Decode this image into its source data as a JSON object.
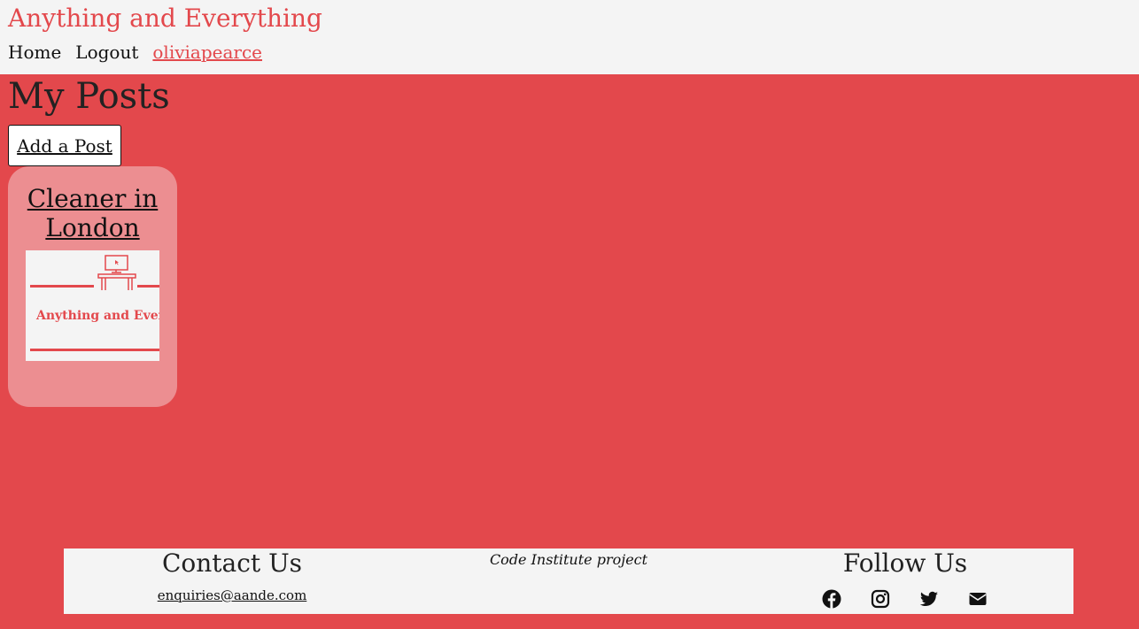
{
  "site": {
    "brand": "Anything and Everything",
    "accent_color": "#e3484c"
  },
  "nav": {
    "items": [
      "Home",
      "Logout"
    ],
    "user": "oliviapearce"
  },
  "main": {
    "title": "My Posts",
    "add_button": "Add a Post",
    "posts": [
      {
        "title": "Cleaner in London",
        "image_logo_text": "Anything and Everything",
        "image_icon": "desk-computer-icon"
      }
    ]
  },
  "footer": {
    "contact_heading": "Contact Us",
    "email": "enquiries@aande.com",
    "credit": "Code Institute project",
    "follow_heading": "Follow Us",
    "socials": [
      "facebook-icon",
      "instagram-icon",
      "twitter-icon",
      "envelope-icon"
    ]
  }
}
